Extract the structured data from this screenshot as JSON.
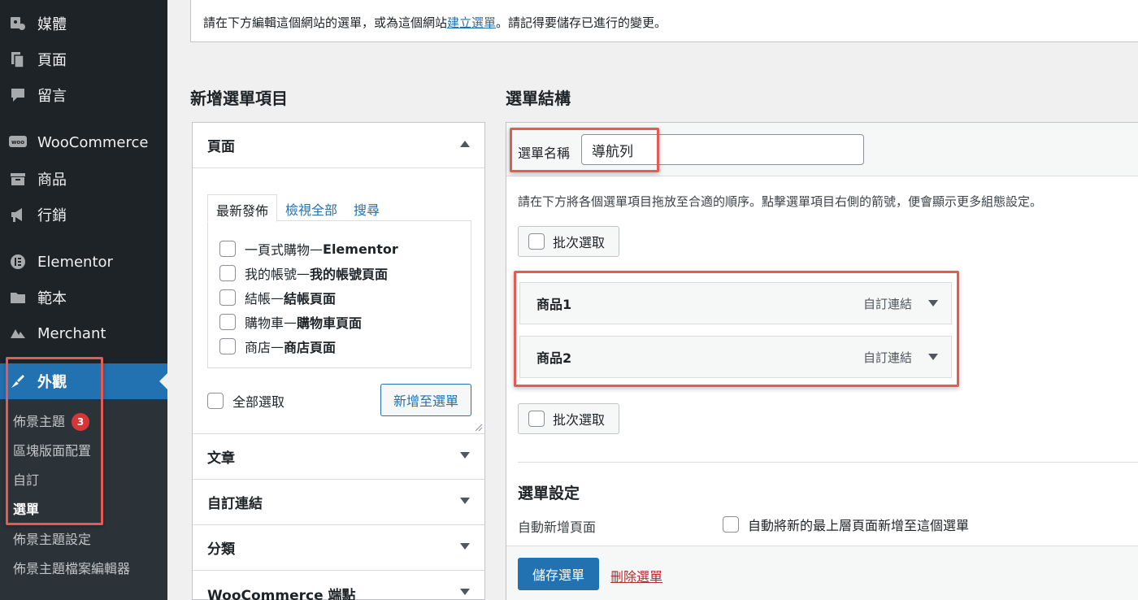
{
  "sidebar": {
    "items": [
      {
        "label": "媒體",
        "icon": "media-icon"
      },
      {
        "label": "頁面",
        "icon": "pages-icon"
      },
      {
        "label": "留言",
        "icon": "comments-icon"
      },
      {
        "label": "WooCommerce",
        "icon": "woocommerce-icon"
      },
      {
        "label": "商品",
        "icon": "products-icon"
      },
      {
        "label": "行銷",
        "icon": "marketing-icon"
      },
      {
        "label": "Elementor",
        "icon": "elementor-icon"
      },
      {
        "label": "範本",
        "icon": "templates-icon"
      },
      {
        "label": "Merchant",
        "icon": "merchant-icon"
      },
      {
        "label": "外觀",
        "icon": "appearance-icon"
      }
    ],
    "submenu": [
      {
        "label": "佈景主題",
        "badge": "3"
      },
      {
        "label": "區塊版面配置"
      },
      {
        "label": "自訂"
      },
      {
        "label": "選單"
      },
      {
        "label": "佈景主題設定"
      },
      {
        "label": "佈景主題檔案編輯器"
      }
    ]
  },
  "notice": {
    "text_before": "請在下方編輯這個網站的選單，或為這個網站",
    "link": "建立選單",
    "text_after": "。請記得要儲存已進行的變更。"
  },
  "add_items": {
    "title": "新增選單項目",
    "pages_section": "頁面",
    "tabs": [
      "最新發佈",
      "檢視全部",
      "搜尋"
    ],
    "pages": [
      {
        "name": "一頁式購物",
        "tag": "Elementor"
      },
      {
        "name": "我的帳號",
        "tag": "我的帳號頁面"
      },
      {
        "name": "結帳",
        "tag": "結帳頁面"
      },
      {
        "name": "購物車",
        "tag": "購物車頁面"
      },
      {
        "name": "商店",
        "tag": "商店頁面"
      }
    ],
    "separator": " — ",
    "select_all": "全部選取",
    "add_button": "新增至選單",
    "sections": [
      "文章",
      "自訂連結",
      "分類",
      "WooCommerce 端點"
    ]
  },
  "structure": {
    "title": "選單結構",
    "name_label": "選單名稱",
    "name_value": "導航列",
    "instructions": "請在下方將各個選單項目拖放至合適的順序。點擊選單項目右側的箭號，便會顯示更多組態設定。",
    "batch_select": "批次選取",
    "menu_items": [
      {
        "title": "商品1",
        "type": "自訂連結"
      },
      {
        "title": "商品2",
        "type": "自訂連結"
      }
    ],
    "settings_title": "選單設定",
    "auto_add_label": "自動新增頁面",
    "auto_add_option": "自動將新的最上層頁面新增至這個選單",
    "save_button": "儲存選單",
    "delete_link": "刪除選單"
  },
  "colors": {
    "sidebar_bg": "#1d2327",
    "accent": "#2271b1",
    "highlight": "#e65a55",
    "badge": "#d63638"
  }
}
